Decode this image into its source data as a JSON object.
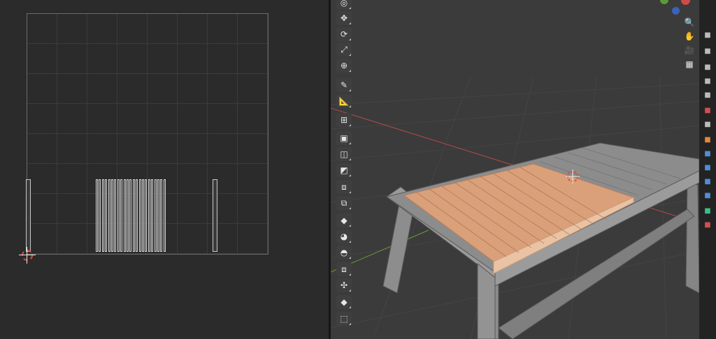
{
  "uv_editor": {
    "grid_color": "#3b3b3b",
    "boundary_color": "#6a6a6a",
    "strip_color": "#d8d8d8"
  },
  "viewport": {
    "x_axis_color": "#b84a4a",
    "y_axis_color": "#6a9a3a",
    "selection_color": "#d9a07a",
    "mesh_color": "#8a8a8a"
  },
  "toolbar": {
    "tools": [
      {
        "icon": "cursor-icon",
        "glyph": "◎"
      },
      {
        "icon": "move-icon",
        "glyph": "✥"
      },
      {
        "icon": "rotate-icon",
        "glyph": "⟳"
      },
      {
        "icon": "scale-icon",
        "glyph": "⤢"
      },
      {
        "icon": "transform-icon",
        "glyph": "⊕"
      },
      {
        "icon": "annotate-icon",
        "glyph": "✎"
      },
      {
        "icon": "measure-icon",
        "glyph": "📐"
      },
      {
        "icon": "add-cube-icon",
        "glyph": "⊞"
      },
      {
        "icon": "extrude-icon",
        "glyph": "▣"
      },
      {
        "icon": "inset-icon",
        "glyph": "◫"
      },
      {
        "icon": "bevel-icon",
        "glyph": "◩"
      },
      {
        "icon": "loop-cut-icon",
        "glyph": "⧈"
      },
      {
        "icon": "knife-icon",
        "glyph": "⧉"
      },
      {
        "icon": "poly-build-icon",
        "glyph": "◆"
      },
      {
        "icon": "spin-icon",
        "glyph": "◕"
      },
      {
        "icon": "smooth-icon",
        "glyph": "◓"
      },
      {
        "icon": "shrink-fatten-icon",
        "glyph": "⧈"
      },
      {
        "icon": "shear-icon",
        "glyph": "✣"
      },
      {
        "icon": "rip-icon",
        "glyph": "◆"
      },
      {
        "icon": "edge-slide-icon",
        "glyph": "⬚"
      }
    ]
  },
  "navigation": {
    "buttons": [
      {
        "icon": "zoom-icon",
        "glyph": "🔍"
      },
      {
        "icon": "pan-hand-icon",
        "glyph": "✋"
      },
      {
        "icon": "camera-view-icon",
        "glyph": "🎥"
      },
      {
        "icon": "perspective-grid-icon",
        "glyph": "▦"
      }
    ]
  },
  "properties": {
    "tabs": [
      {
        "icon": "tool-settings-icon",
        "color": "#bbbbbb"
      },
      {
        "icon": "render-icon",
        "color": "#bbbbbb"
      },
      {
        "icon": "output-icon",
        "color": "#bbbbbb"
      },
      {
        "icon": "view-layer-icon",
        "color": "#bbbbbb"
      },
      {
        "icon": "scene-icon",
        "color": "#bbbbbb"
      },
      {
        "icon": "world-icon",
        "color": "#d05050"
      },
      {
        "icon": "collection-icon",
        "color": "#bbbbbb"
      },
      {
        "icon": "object-icon",
        "color": "#e08a3a"
      },
      {
        "icon": "modifier-icon",
        "color": "#4e8fd6"
      },
      {
        "icon": "particles-icon",
        "color": "#4e8fd6"
      },
      {
        "icon": "physics-icon",
        "color": "#4e8fd6"
      },
      {
        "icon": "constraints-icon",
        "color": "#4e8fd6"
      },
      {
        "icon": "data-icon",
        "color": "#3ac08a"
      },
      {
        "icon": "material-icon",
        "color": "#d05050"
      }
    ]
  }
}
